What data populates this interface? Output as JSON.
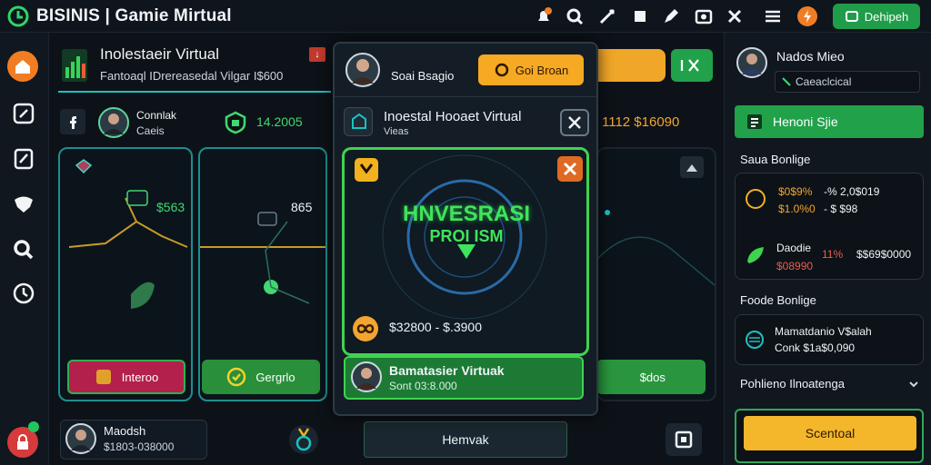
{
  "header": {
    "title": "BISINIS | Gamie Mirtual",
    "icons": [
      "logo-icon",
      "notification-icon",
      "search-icon",
      "tools-icon",
      "flag-icon",
      "pen-icon",
      "camera-icon",
      "close-icon",
      "menu-icon",
      "bolt-icon"
    ],
    "deposit_label": "Dehipeh"
  },
  "colors": {
    "accent_green": "#22a14b",
    "accent_orange": "#f0a628",
    "accent_teal": "#19c2c2",
    "alert_red": "#d63a3a"
  },
  "sidebar": {
    "items": [
      "home-icon",
      "edit-icon",
      "note-icon",
      "chat-icon",
      "search-icon",
      "clock-icon",
      "lock-icon"
    ]
  },
  "panel": {
    "title": "Inolestaeir Virtual",
    "subtitle": "Fantoaql IDrereasedal Vilgar I$600",
    "contact_label": "Connlak",
    "contact_sub": "Caeis",
    "score": "14.2005",
    "card_values": [
      "$563",
      "865"
    ],
    "interest_label": "Interoo",
    "graphic_label": "Gergrlo",
    "right_value": "1112 $16090",
    "right_btn_label": " $dos"
  },
  "modal": {
    "user_name": "Soai Bsagio",
    "orange_btn": "Goi Broan",
    "title": "Inoestal Hooaet Virtual",
    "subtitle": "Vieas",
    "heading": "HNVESRASI",
    "subheading": "PROI ISM",
    "range": "$32800 - $.3900",
    "bottom_name": "Bamatasier Virtuak",
    "bottom_sub": "Sont 03:8.000"
  },
  "bottom": {
    "name": "Maodsh",
    "amount": "$1803-038000",
    "main_btn": "Hemvak"
  },
  "right_panel": {
    "user_name": "Nados Mieo",
    "search_text": "Caeaclcical",
    "green_btn": "Henoni Sjie",
    "section_1": "Saua Bonlige",
    "row_1a": "$0$9%",
    "row_1b": "-% 2,0$019",
    "row_2a": "$1.0%0",
    "row_2b": "- $ $98",
    "row_3a": "Daodie",
    "row_3b": "11%",
    "row_3c": "$$69$0000",
    "row_4": "$08990",
    "section_2": "Foode Bonlige",
    "box2_title": "Mamatdanio V$alah",
    "box2_sub": "Conk $1a$0,090",
    "section_3": "Pohlieno Ilnoatenga",
    "yellow_btn": "Scentoal"
  }
}
